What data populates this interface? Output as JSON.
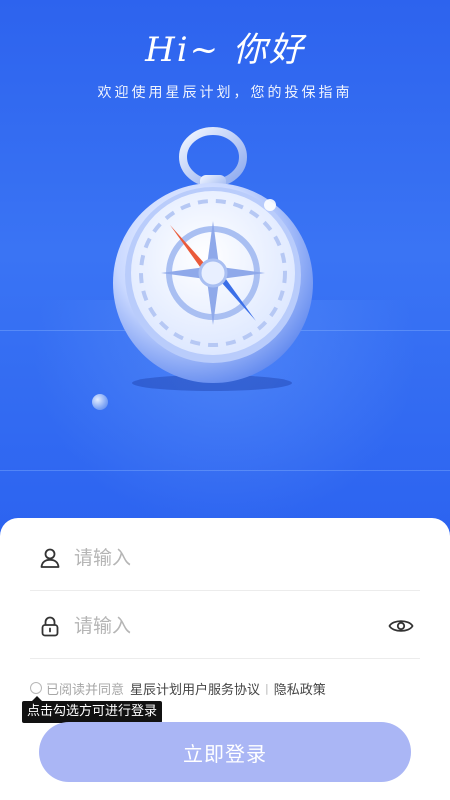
{
  "header": {
    "title": "Hi~ 你好",
    "subtitle": "欢迎使用星辰计划，您的投保指南"
  },
  "form": {
    "username": {
      "placeholder": "请输入",
      "icon": "user-icon"
    },
    "password": {
      "placeholder": "请输入",
      "icon": "lock-icon",
      "toggle_icon": "eye-icon"
    }
  },
  "agreement": {
    "prefix": "已阅读并同意",
    "service_link": "星辰计划用户服务协议",
    "separator": "|",
    "privacy_link": "隐私政策",
    "checked": false
  },
  "tooltip": {
    "text": "点击勾选方可进行登录"
  },
  "login_button": {
    "label": "立即登录"
  },
  "colors": {
    "background": "#2e63f0",
    "button": "#aab6f5",
    "panel": "#ffffff"
  }
}
